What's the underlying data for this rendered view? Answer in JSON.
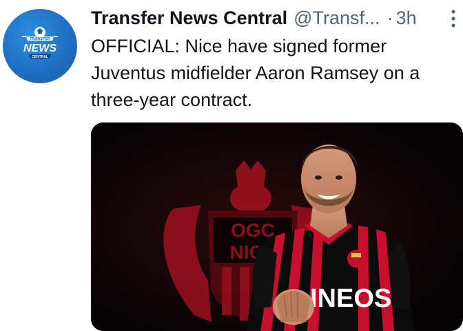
{
  "tweet": {
    "author": {
      "display_name": "Transfer News Central",
      "handle": "@Transf...",
      "avatar_text": {
        "top": "TRANSFER",
        "main": "NEWS",
        "bottom": "CENTRAL"
      }
    },
    "separator": "·",
    "time": "3h",
    "more_icon": "vertical-ellipsis-icon",
    "text_lines": [
      "OFFICIAL: Nice have signed former",
      "Juventus midfielder Aaron Ramsey on a",
      "three-year contract."
    ],
    "media": {
      "crest_text": [
        "OGC",
        "NICE"
      ],
      "jersey_text": "INEOS",
      "colors": {
        "red": "#c8102e",
        "black": "#0b0b0b"
      }
    }
  },
  "colors": {
    "text": "#0f1419",
    "secondary": "#536471",
    "avatar_blue": "#1f6fc4"
  }
}
